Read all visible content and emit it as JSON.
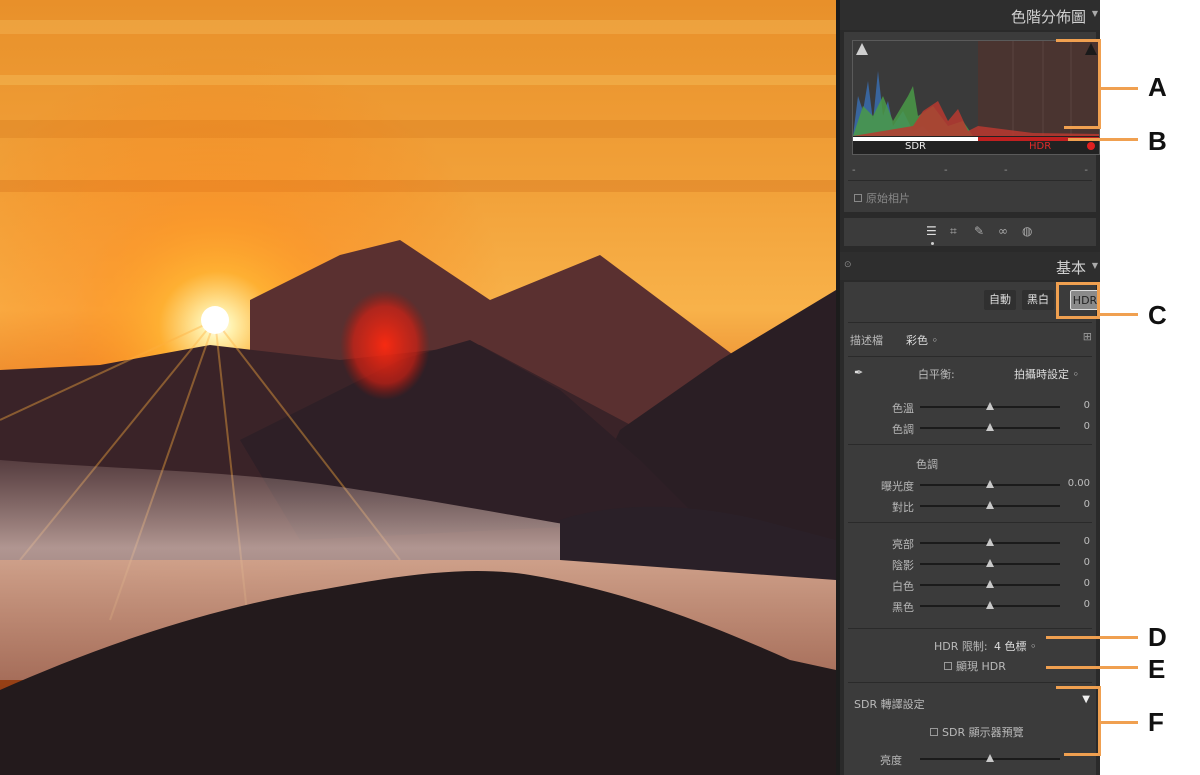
{
  "panel": {
    "histogram_title": "色階分佈圖",
    "sdr_label": "SDR",
    "hdr_label": "HDR",
    "dashes": [
      "-",
      "-",
      "-",
      "-"
    ],
    "original_photo": "原始相片",
    "basic_title": "基本",
    "btn_auto": "自動",
    "btn_bw": "黑白",
    "btn_hdr": "HDR",
    "profile_label": "描述檔",
    "profile_value": "彩色 ◦",
    "wb_label": "白平衡:",
    "wb_value": "拍攝時設定 ◦",
    "wb_sliders": [
      {
        "label": "色溫",
        "value": "0",
        "level": 0.5
      },
      {
        "label": "色調",
        "value": "0",
        "level": 0.5
      }
    ],
    "tone_label": "色調",
    "tone_sliders": [
      {
        "label": "曝光度",
        "value": "0.00",
        "level": 0.5
      },
      {
        "label": "對比",
        "value": "0",
        "level": 0.5
      }
    ],
    "presence_sliders": [
      {
        "label": "亮部",
        "value": "0",
        "level": 0.5
      },
      {
        "label": "陰影",
        "value": "0",
        "level": 0.5
      },
      {
        "label": "白色",
        "value": "0",
        "level": 0.5
      },
      {
        "label": "黑色",
        "value": "0",
        "level": 0.5
      }
    ],
    "hdr_limit_label": "HDR 限制:",
    "hdr_limit_value": "4 色標 ◦",
    "show_hdr": "顯現 HDR",
    "sdr_settings": "SDR 轉譯設定",
    "sdr_preview": "SDR 顯示器預覽",
    "brightness_label": "亮度",
    "brightness_level": 0.5,
    "colors": {
      "panel_bg": "#3b3b3b",
      "accent": "#f0a050",
      "hdr_red": "#d02020"
    }
  },
  "callouts": [
    "A",
    "B",
    "C",
    "D",
    "E",
    "F"
  ]
}
